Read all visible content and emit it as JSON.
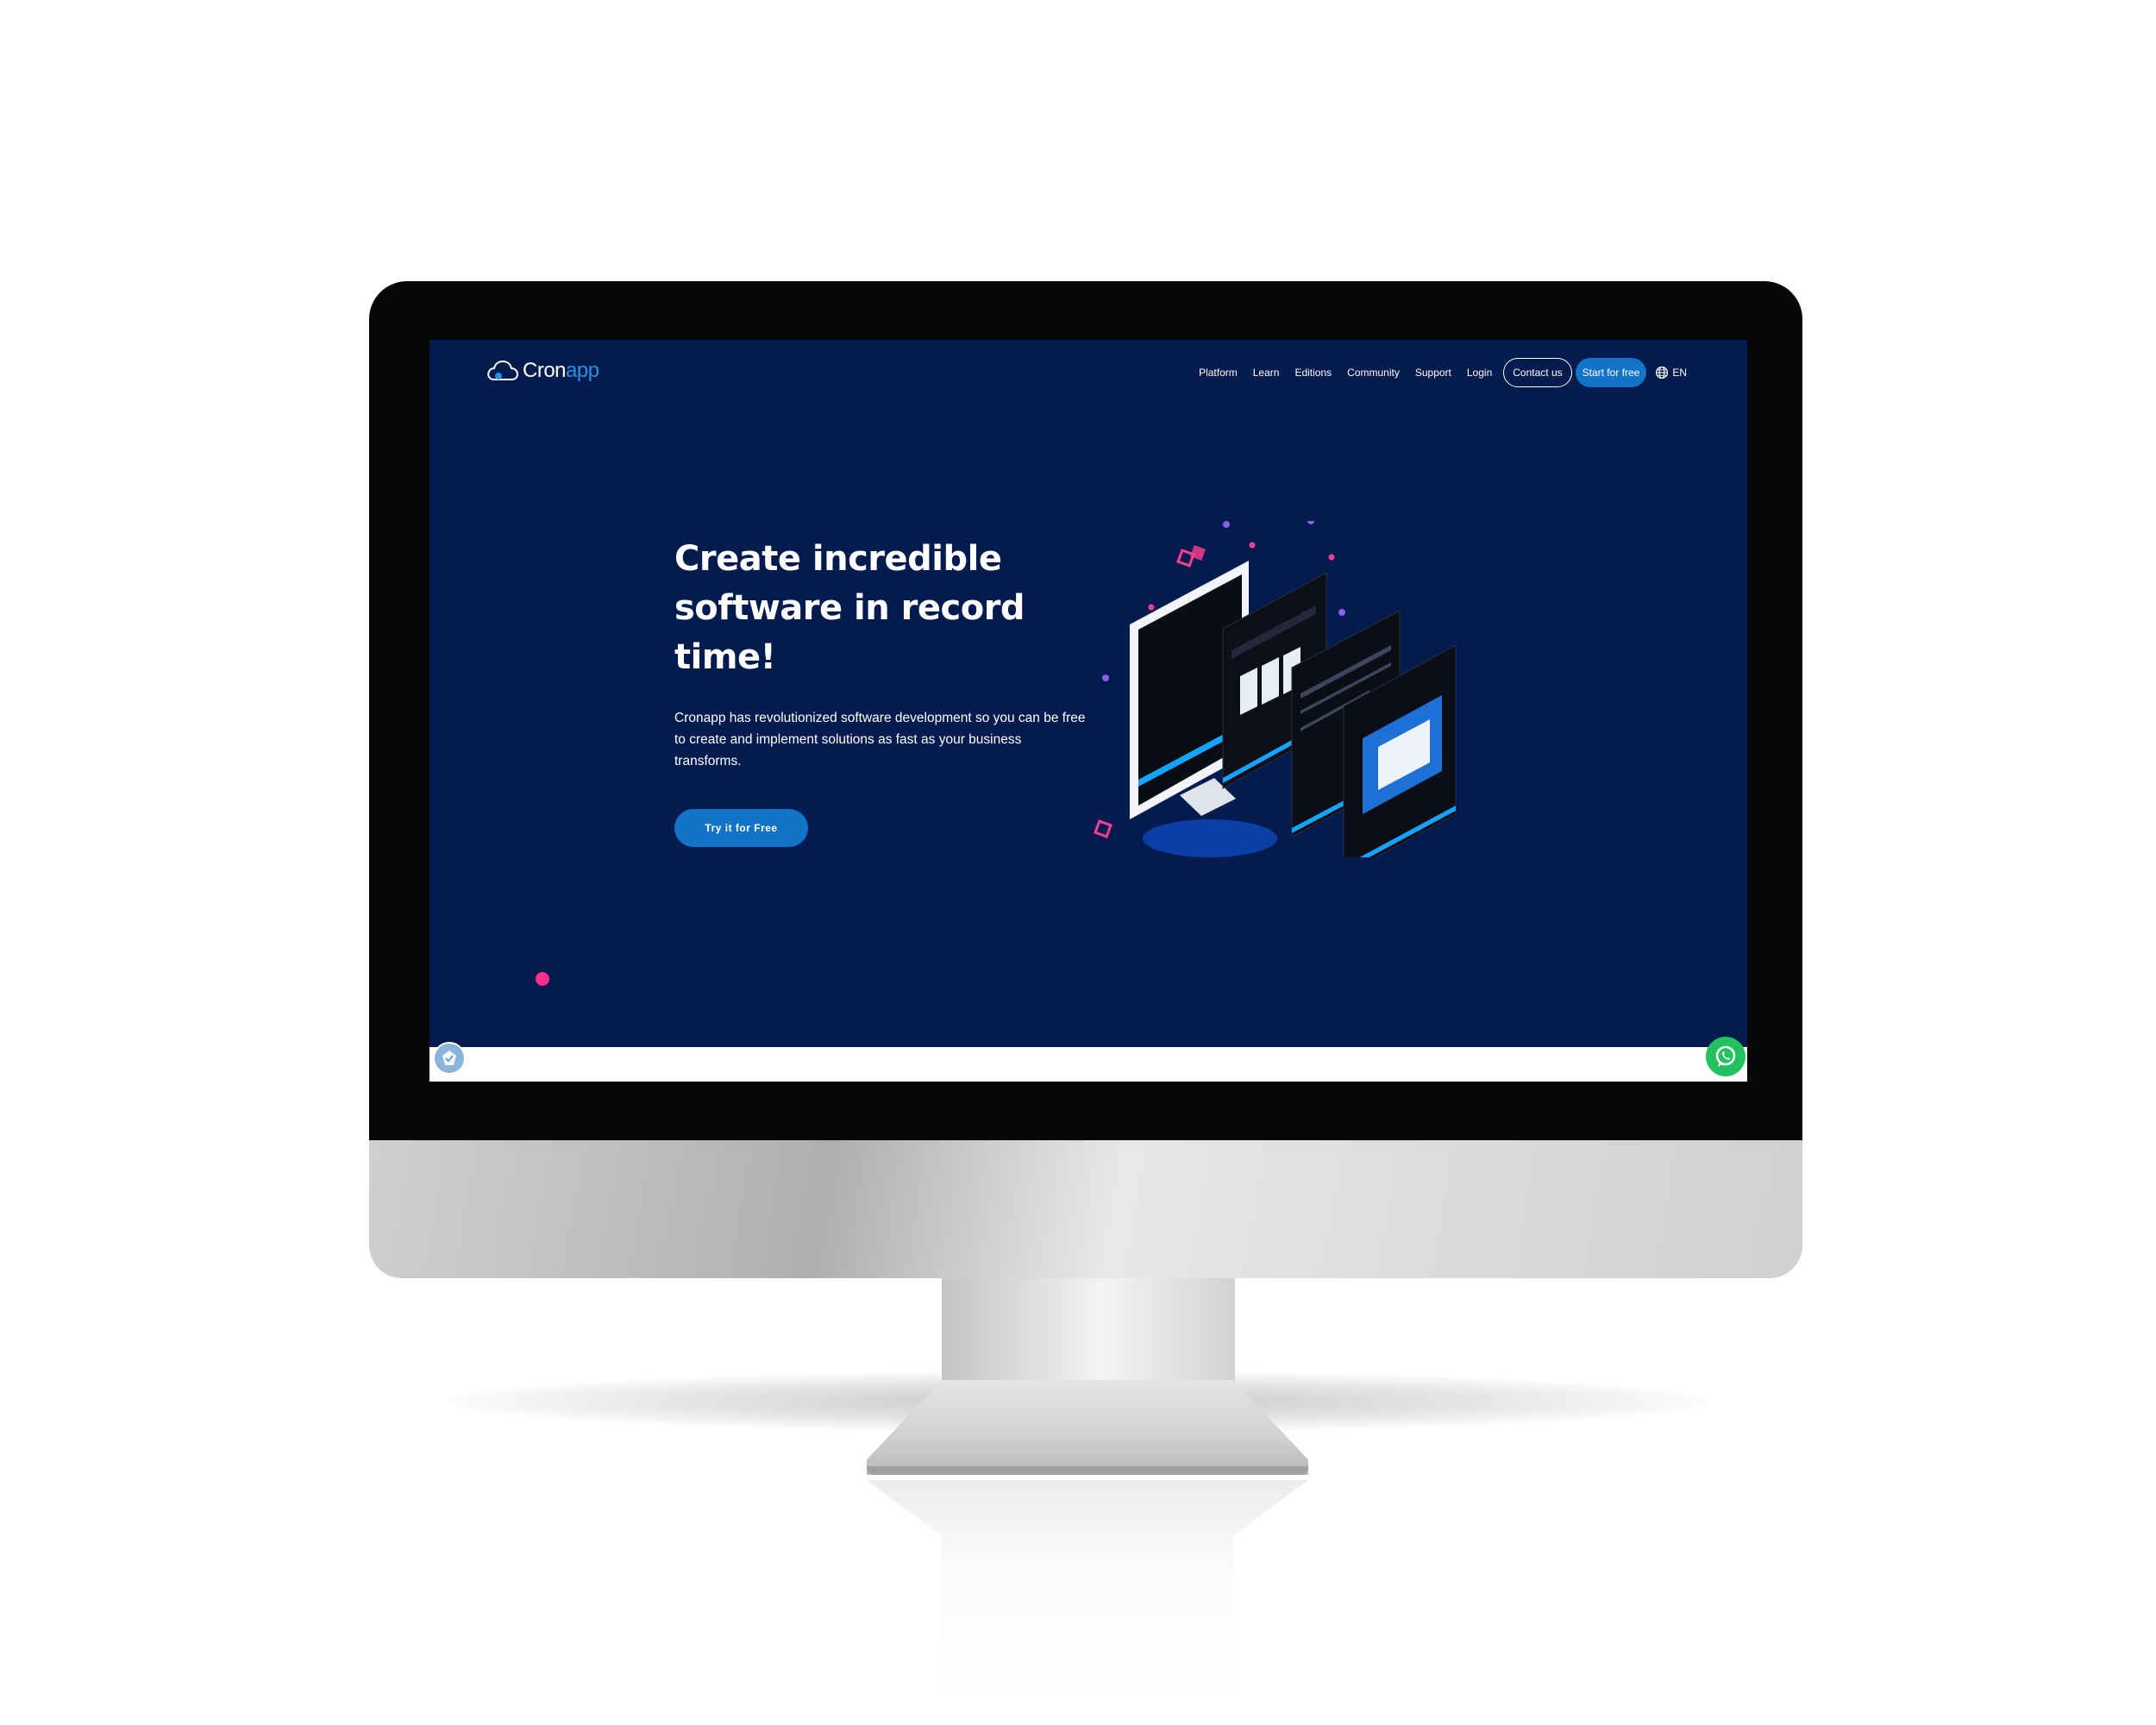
{
  "brand": {
    "name_part1": "Cron",
    "name_part2": "app",
    "accent_color": "#2a8fe3",
    "background_color": "#031b4e",
    "button_color": "#1273c9"
  },
  "nav": {
    "items": [
      {
        "label": "Platform"
      },
      {
        "label": "Learn"
      },
      {
        "label": "Editions"
      },
      {
        "label": "Community"
      },
      {
        "label": "Support"
      },
      {
        "label": "Login"
      }
    ],
    "contact_label": "Contact us",
    "start_label": "Start for free",
    "language": "EN"
  },
  "hero": {
    "title": "Create incredible software in record time!",
    "subtitle": "Cronapp has revolutionized software development so you can be free to create and implement solutions as fast as your business transforms.",
    "cta_label": "Try it for Free"
  },
  "icons": {
    "logo": "cloud-logo-icon",
    "language": "globe-icon",
    "left_widget": "badge-check-icon",
    "right_widget": "whatsapp-icon"
  }
}
